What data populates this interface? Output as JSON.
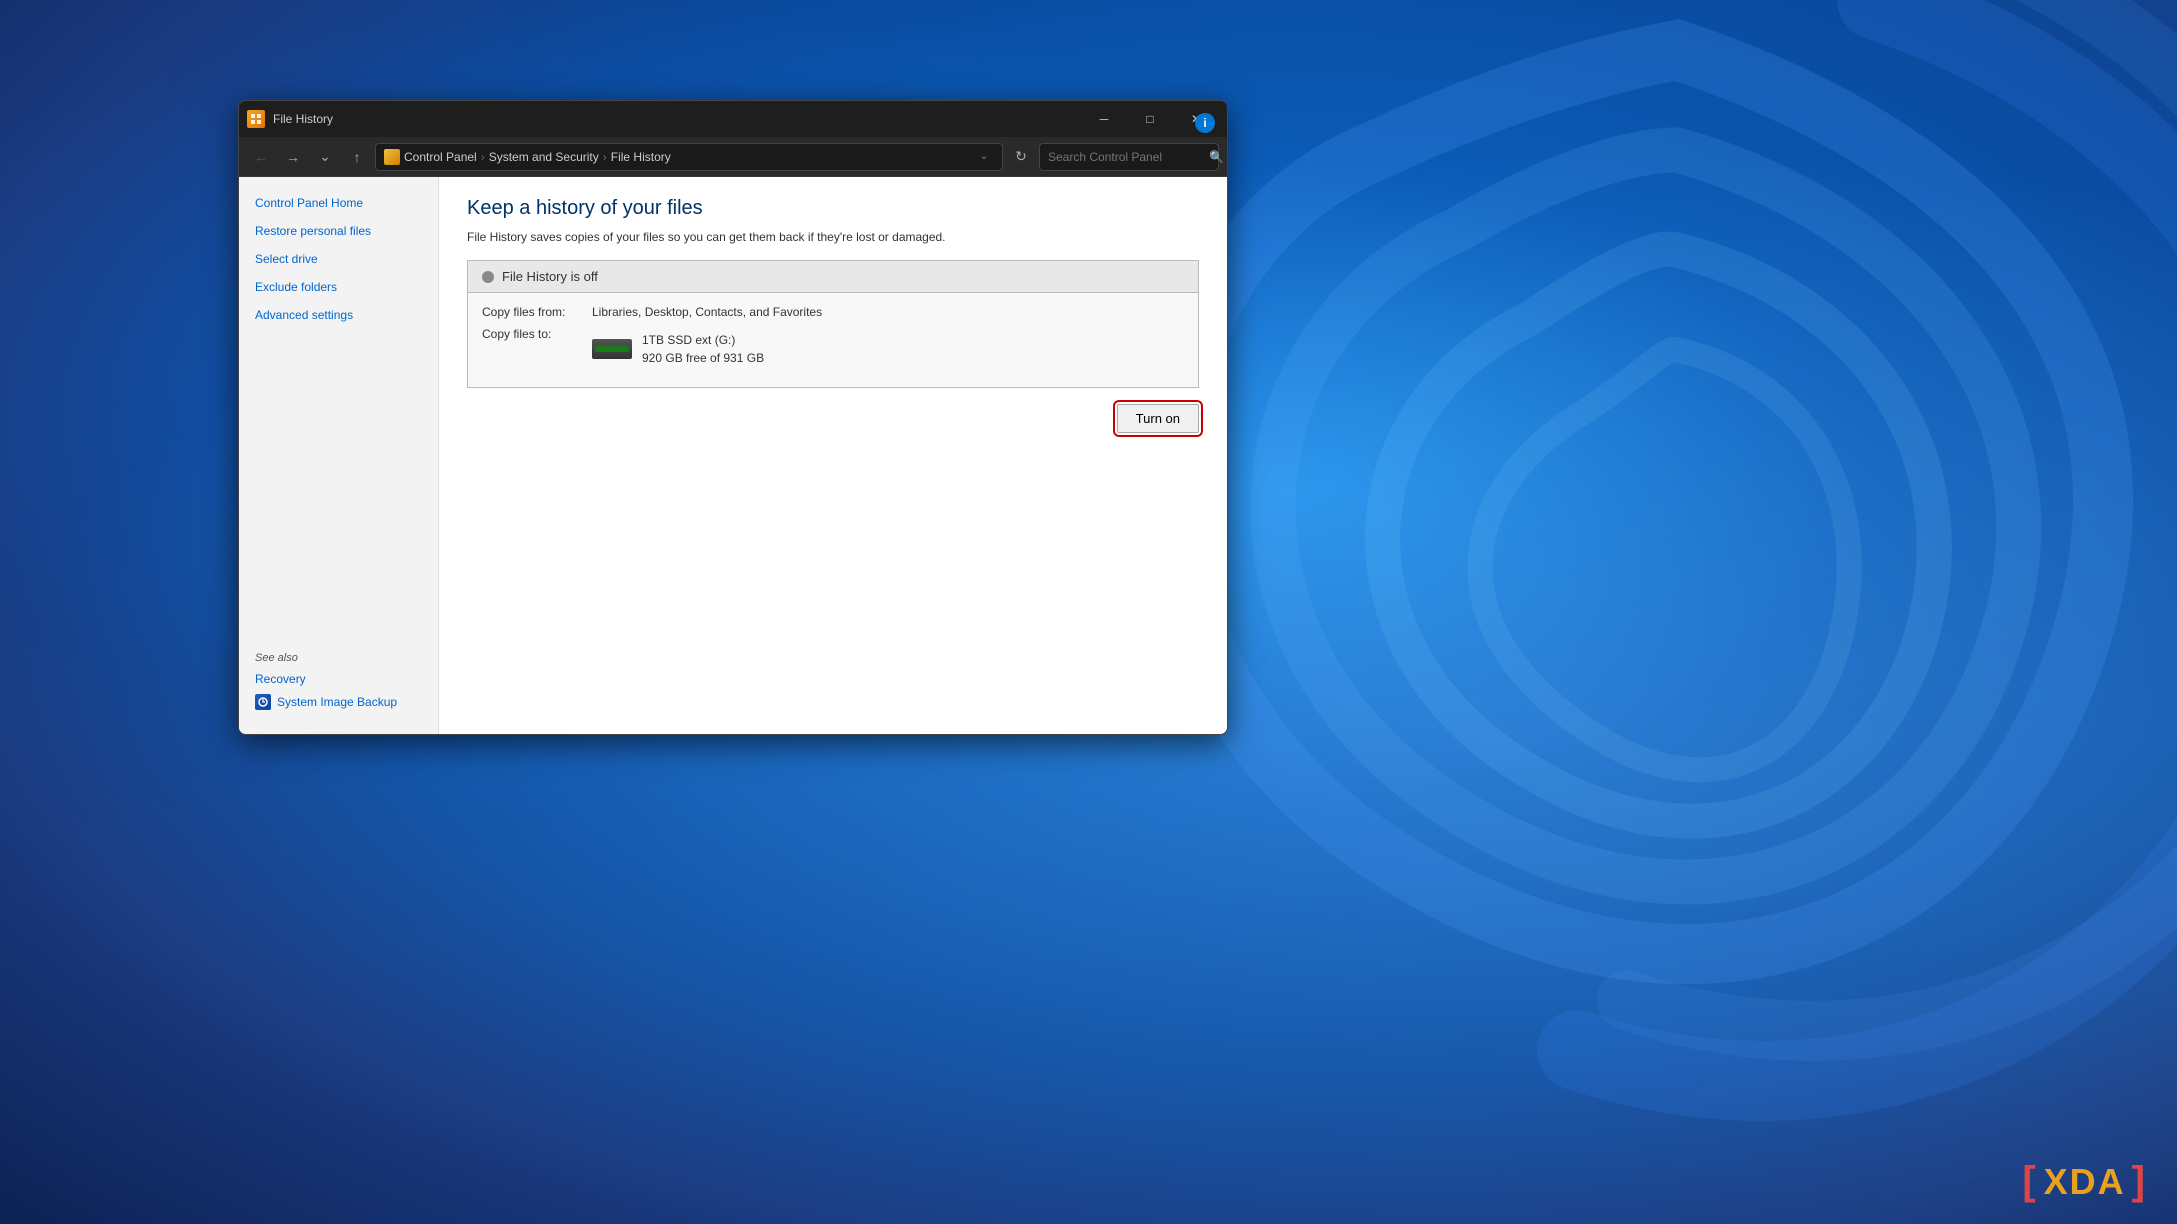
{
  "wallpaper": {
    "alt": "Windows 11 blue swirl wallpaper"
  },
  "window": {
    "title": "File History",
    "icon_alt": "File History icon"
  },
  "window_controls": {
    "minimize": "─",
    "maximize": "□",
    "close": "✕"
  },
  "address_bar": {
    "nav_back": "←",
    "nav_forward": "→",
    "nav_dropdown": "⌄",
    "nav_up": "↑",
    "breadcrumb": [
      "Control Panel",
      "System and Security",
      "File History"
    ],
    "breadcrumb_sep": "›",
    "refresh": "↻",
    "search_placeholder": "Search Control Panel",
    "search_icon": "🔍"
  },
  "sidebar": {
    "nav_items": [
      {
        "label": "Control Panel Home",
        "id": "control-panel-home"
      },
      {
        "label": "Restore personal files",
        "id": "restore-personal-files"
      },
      {
        "label": "Select drive",
        "id": "select-drive"
      },
      {
        "label": "Exclude folders",
        "id": "exclude-folders"
      },
      {
        "label": "Advanced settings",
        "id": "advanced-settings"
      }
    ],
    "see_also": "See also",
    "footer_items": [
      {
        "label": "Recovery",
        "id": "recovery",
        "icon": false
      },
      {
        "label": "System Image Backup",
        "id": "system-image-backup",
        "icon": true
      }
    ]
  },
  "main": {
    "title": "Keep a history of your files",
    "description": "File History saves copies of your files so you can get them back if they're lost or damaged.",
    "status_header": "File History is off",
    "copy_files_from_label": "Copy files from:",
    "copy_files_from_value": "Libraries, Desktop, Contacts, and Favorites",
    "copy_files_to_label": "Copy files to:",
    "drive_name": "1TB SSD ext (G:)",
    "drive_free": "920 GB free of 931 GB",
    "turn_on_button": "Turn on"
  },
  "xda": {
    "logo": "XDA"
  }
}
